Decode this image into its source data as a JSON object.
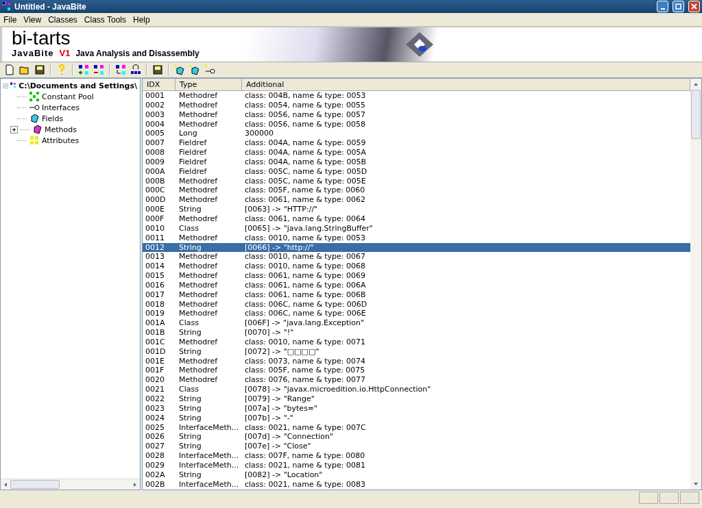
{
  "window": {
    "title": "Untitled - JavaBite"
  },
  "menu": [
    "File",
    "View",
    "Classes",
    "Class Tools",
    "Help"
  ],
  "banner": {
    "brand": "bi-tarts",
    "product": "JavaBite",
    "version": "V1",
    "tagline": "Java Analysis and Disassembly"
  },
  "tree": {
    "label": "C:\\Documents and Settings\\",
    "expanded": true,
    "children": [
      {
        "label": "Constant Pool",
        "kind": "pool"
      },
      {
        "label": "Interfaces",
        "kind": "interface"
      },
      {
        "label": "Fields",
        "kind": "field"
      },
      {
        "label": "Methods",
        "kind": "method",
        "expanded": false
      },
      {
        "label": "Attributes",
        "kind": "attribute"
      }
    ]
  },
  "table": {
    "columns": [
      "IDX",
      "Type",
      "Additional"
    ],
    "rows": [
      {
        "idx": "0001",
        "type": "Methodref",
        "additional": "class: 004B, name & type: 0053",
        "selected": false
      },
      {
        "idx": "0002",
        "type": "Methodref",
        "additional": "class: 0054, name & type: 0055",
        "selected": false
      },
      {
        "idx": "0003",
        "type": "Methodref",
        "additional": "class: 0056, name & type: 0057",
        "selected": false
      },
      {
        "idx": "0004",
        "type": "Methodref",
        "additional": "class: 0056, name & type: 0058",
        "selected": false
      },
      {
        "idx": "0005",
        "type": "Long",
        "additional": "300000",
        "selected": false
      },
      {
        "idx": "0007",
        "type": "Fieldref",
        "additional": "class: 004A, name & type: 0059",
        "selected": false
      },
      {
        "idx": "0008",
        "type": "Fieldref",
        "additional": "class: 004A, name & type: 005A",
        "selected": false
      },
      {
        "idx": "0009",
        "type": "Fieldref",
        "additional": "class: 004A, name & type: 005B",
        "selected": false
      },
      {
        "idx": "000A",
        "type": "Fieldref",
        "additional": "class: 005C, name & type: 005D",
        "selected": false
      },
      {
        "idx": "000B",
        "type": "Methodref",
        "additional": "class: 005C, name & type: 005E",
        "selected": false
      },
      {
        "idx": "000C",
        "type": "Methodref",
        "additional": "class: 005F, name & type: 0060",
        "selected": false
      },
      {
        "idx": "000D",
        "type": "Methodref",
        "additional": "class: 0061, name & type: 0062",
        "selected": false
      },
      {
        "idx": "000E",
        "type": "String",
        "additional": "[0063] -> \"HTTP://\"",
        "selected": false
      },
      {
        "idx": "000F",
        "type": "Methodref",
        "additional": "class: 0061, name & type: 0064",
        "selected": false
      },
      {
        "idx": "0010",
        "type": "Class",
        "additional": "[0065] -> \"java.lang.StringBuffer\"",
        "selected": false
      },
      {
        "idx": "0011",
        "type": "Methodref",
        "additional": "class: 0010, name & type: 0053",
        "selected": false
      },
      {
        "idx": "0012",
        "type": "String",
        "additional": "[0066] -> \"http://\"",
        "selected": true
      },
      {
        "idx": "0013",
        "type": "Methodref",
        "additional": "class: 0010, name & type: 0067",
        "selected": false
      },
      {
        "idx": "0014",
        "type": "Methodref",
        "additional": "class: 0010, name & type: 0068",
        "selected": false
      },
      {
        "idx": "0015",
        "type": "Methodref",
        "additional": "class: 0061, name & type: 0069",
        "selected": false
      },
      {
        "idx": "0016",
        "type": "Methodref",
        "additional": "class: 0061, name & type: 006A",
        "selected": false
      },
      {
        "idx": "0017",
        "type": "Methodref",
        "additional": "class: 0061, name & type: 006B",
        "selected": false
      },
      {
        "idx": "0018",
        "type": "Methodref",
        "additional": "class: 006C, name & type: 006D",
        "selected": false
      },
      {
        "idx": "0019",
        "type": "Methodref",
        "additional": "class: 006C, name & type: 006E",
        "selected": false
      },
      {
        "idx": "001A",
        "type": "Class",
        "additional": "[006F] -> \"java.lang.Exception\"",
        "selected": false
      },
      {
        "idx": "001B",
        "type": "String",
        "additional": "[0070] -> \"!\"",
        "selected": false
      },
      {
        "idx": "001C",
        "type": "Methodref",
        "additional": "class: 0010, name & type: 0071",
        "selected": false
      },
      {
        "idx": "001D",
        "type": "String",
        "additional": "[0072] -> \"□□□□\"",
        "selected": false
      },
      {
        "idx": "001E",
        "type": "Methodref",
        "additional": "class: 0073, name & type: 0074",
        "selected": false
      },
      {
        "idx": "001F",
        "type": "Methodref",
        "additional": "class: 005F, name & type: 0075",
        "selected": false
      },
      {
        "idx": "0020",
        "type": "Methodref",
        "additional": "class: 0076, name & type: 0077",
        "selected": false
      },
      {
        "idx": "0021",
        "type": "Class",
        "additional": "[0078] -> \"javax.microedition.io.HttpConnection\"",
        "selected": false
      },
      {
        "idx": "0022",
        "type": "String",
        "additional": "[0079] -> \"Range\"",
        "selected": false
      },
      {
        "idx": "0023",
        "type": "String",
        "additional": "[007a] -> \"bytes=\"",
        "selected": false
      },
      {
        "idx": "0024",
        "type": "String",
        "additional": "[007b] -> \"-\"",
        "selected": false
      },
      {
        "idx": "0025",
        "type": "InterfaceMeth...",
        "additional": "class: 0021, name & type: 007C",
        "selected": false
      },
      {
        "idx": "0026",
        "type": "String",
        "additional": "[007d] -> \"Connection\"",
        "selected": false
      },
      {
        "idx": "0027",
        "type": "String",
        "additional": "[007e] -> \"Close\"",
        "selected": false
      },
      {
        "idx": "0028",
        "type": "InterfaceMeth...",
        "additional": "class: 007F, name & type: 0080",
        "selected": false
      },
      {
        "idx": "0029",
        "type": "InterfaceMeth...",
        "additional": "class: 0021, name & type: 0081",
        "selected": false
      },
      {
        "idx": "002A",
        "type": "String",
        "additional": "[0082] -> \"Location\"",
        "selected": false
      },
      {
        "idx": "002B",
        "type": "InterfaceMeth...",
        "additional": "class: 0021, name & type: 0083",
        "selected": false
      }
    ]
  }
}
